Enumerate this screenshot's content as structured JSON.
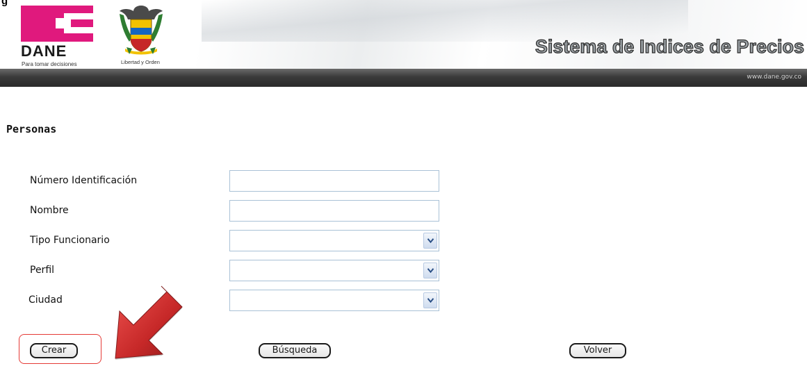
{
  "header": {
    "corner_text": "g",
    "dane_wordmark": "DANE",
    "dane_tagline": "Para tomar decisiones",
    "coat_caption": "Libertad y Orden",
    "system_title": "Sistema de Indices de Precios",
    "site_url": "www.dane.gov.co",
    "brand_color": "#e0197d"
  },
  "page": {
    "heading": "Personas"
  },
  "form": {
    "fields": [
      {
        "label": "Número Identificación",
        "type": "text",
        "value": ""
      },
      {
        "label": "Nombre",
        "type": "text",
        "value": ""
      },
      {
        "label": "Tipo Funcionario",
        "type": "select",
        "value": ""
      },
      {
        "label": "Perfil",
        "type": "select",
        "value": ""
      },
      {
        "label": "Ciudad",
        "type": "select",
        "value": ""
      }
    ]
  },
  "actions": {
    "create_label": "Crear",
    "search_label": "Búsqueda",
    "back_label": "Volver"
  },
  "annotation": {
    "highlight_color": "#e53935",
    "arrow_color": "#c62828",
    "icon": "pointer-arrow-icon"
  }
}
